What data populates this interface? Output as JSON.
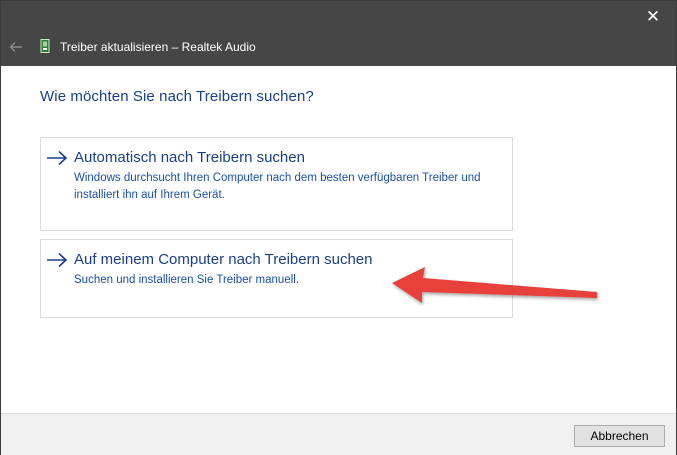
{
  "window": {
    "title": "Treiber aktualisieren – Realtek Audio",
    "close_glyph": "✕",
    "back_glyph": "🡐",
    "icon": "device-card-icon"
  },
  "main": {
    "heading": "Wie möchten Sie nach Treibern suchen?",
    "options": [
      {
        "title": "Automatisch nach Treibern suchen",
        "description": "Windows durchsucht Ihren Computer nach dem besten verfügbaren Treiber und installiert ihn auf Ihrem Gerät.",
        "icon": "arrow-right-icon"
      },
      {
        "title": "Auf meinem Computer nach Treibern suchen",
        "description": "Suchen und installieren Sie Treiber manuell.",
        "icon": "arrow-right-icon"
      }
    ]
  },
  "annotation": {
    "icon": "red-annotation-arrow",
    "color": "#e8403a"
  },
  "footer": {
    "cancel_label": "Abbrechen"
  },
  "colors": {
    "titlebar": "#464646",
    "link_blue": "#1a3e8c",
    "desc_blue": "#1a4fa8",
    "footer_bg": "#f0f0f0"
  }
}
